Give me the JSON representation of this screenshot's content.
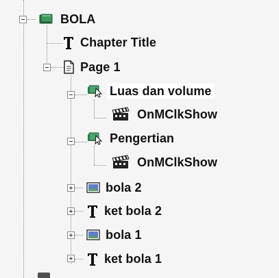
{
  "tree": {
    "root": {
      "label": "BOLA"
    },
    "chapter_title": {
      "label": "Chapter Title"
    },
    "page1": {
      "label": "Page 1"
    },
    "luas": {
      "label": "Luas dan volume"
    },
    "luas_action": {
      "label": "OnMClkShow"
    },
    "pengertian": {
      "label": "Pengertian"
    },
    "pengertian_action": {
      "label": "OnMClkShow"
    },
    "bola2": {
      "label": "bola 2"
    },
    "ket_bola2": {
      "label": "ket bola 2"
    },
    "bola1": {
      "label": "bola 1"
    },
    "ket_bola1": {
      "label": "ket bola 1"
    }
  },
  "icons": {
    "book": "book-icon",
    "text": "text-icon",
    "page": "page-icon",
    "interaction": "interaction-icon",
    "clapper": "clapper-icon",
    "image": "image-icon"
  },
  "colors": {
    "background": "#f5f5f5",
    "selection": "#ffffff",
    "tree_line": "#8c8c8c",
    "book_green": "#2f7d4a",
    "image_blue": "#4f74c7"
  }
}
